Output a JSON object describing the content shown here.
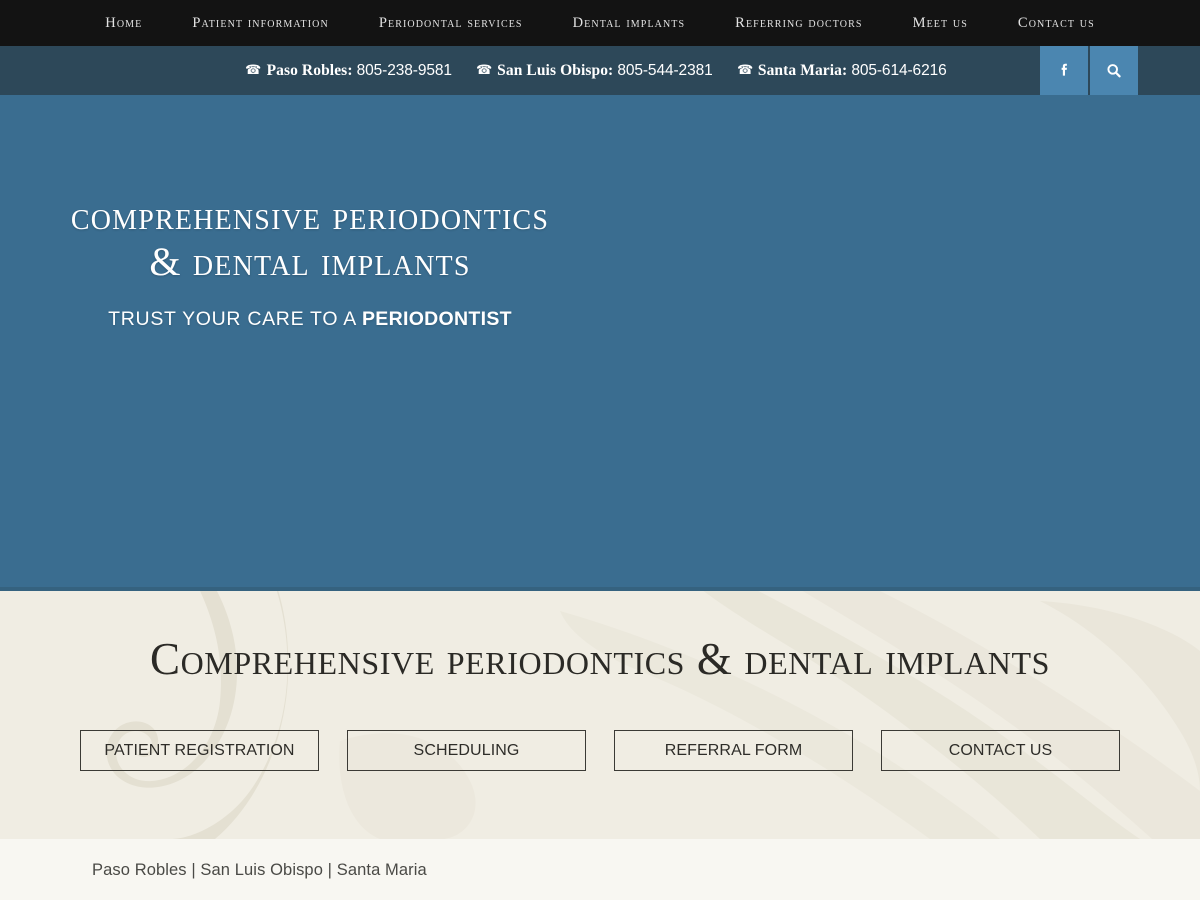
{
  "nav": {
    "items": [
      {
        "label": "Home",
        "name": "nav-item-home"
      },
      {
        "label": "Patient Information",
        "name": "nav-item-patient-information"
      },
      {
        "label": "Periodontal Services",
        "name": "nav-item-periodontal-services"
      },
      {
        "label": "Dental Implants",
        "name": "nav-item-dental-implants"
      },
      {
        "label": "Referring Doctors",
        "name": "nav-item-referring-doctors"
      },
      {
        "label": "Meet Us",
        "name": "nav-item-meet-us"
      },
      {
        "label": "Contact Us",
        "name": "nav-item-contact-us"
      }
    ]
  },
  "contact_bar": {
    "phones": [
      {
        "label": "Paso Robles:",
        "number": "805-238-9581"
      },
      {
        "label": "San Luis Obispo:",
        "number": "805-544-2381"
      },
      {
        "label": "Santa Maria:",
        "number": "805-614-6216"
      }
    ],
    "facebook_icon": "facebook-icon",
    "search_icon": "search-icon"
  },
  "hero": {
    "title_line1": "Comprehensive Periodontics",
    "title_line2": "& Dental Implants",
    "tagline_prefix": "TRUST YOUR CARE TO A ",
    "tagline_emphasis": "PERIODONTIST"
  },
  "welcome": {
    "heading": "Comprehensive Periodontics & Dental Implants",
    "buttons": [
      {
        "label": "Patient Registration",
        "name": "patient-registration-button"
      },
      {
        "label": "Scheduling",
        "name": "scheduling-button"
      },
      {
        "label": "Referral Form",
        "name": "referral-form-button"
      },
      {
        "label": "Contact Us",
        "name": "contact-us-button"
      }
    ]
  },
  "footer": {
    "locations": "Paso Robles | San Luis Obispo | Santa Maria"
  },
  "colors": {
    "nav_background": "#131313",
    "contact_bar_background": "#2d4859",
    "hero_background": "#3a6d90",
    "icon_button_background": "#4b86b0",
    "band_background": "#f0ede3",
    "footer_background": "#f8f7f2",
    "band_text": "#2b2a26"
  }
}
